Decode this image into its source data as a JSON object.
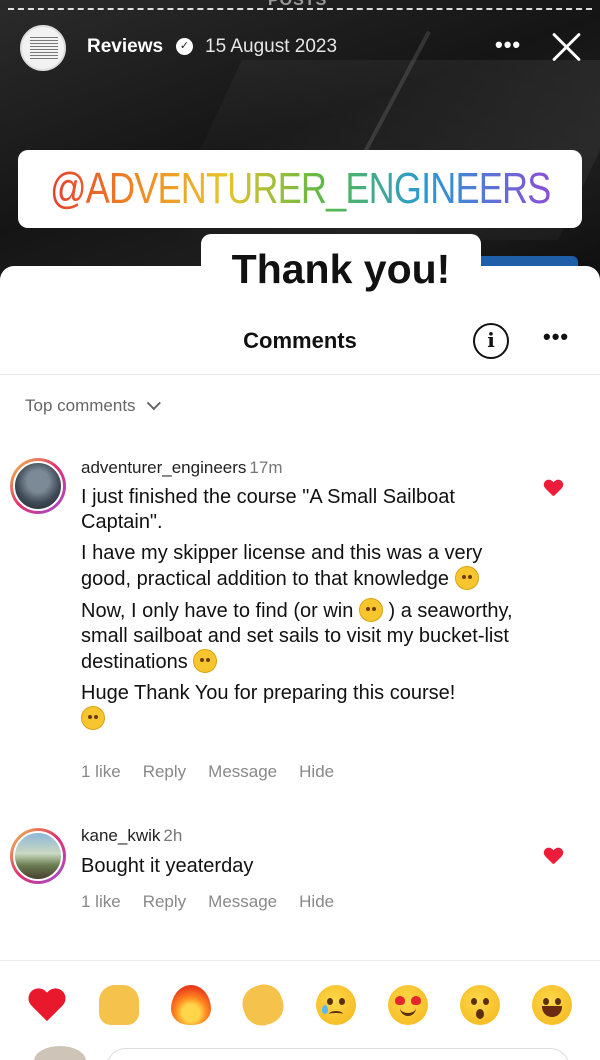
{
  "story": {
    "peek_label": "POSTS",
    "account_name": "Reviews",
    "date": "15 August 2023",
    "more_label": "•••",
    "mention": "@ADVENTURER_ENGINEERS",
    "thanks": "Thank you!"
  },
  "sheet": {
    "title": "Comments",
    "more_label": "•••",
    "info_label": "i",
    "sort_label": "Top comments"
  },
  "comments": [
    {
      "username": "adventurer_engineers",
      "time": "17m",
      "paragraphs": [
        "I just finished the course \"A Small Sailboat Captain\".",
        "I have my skipper license and this was a very good, practical addition to that knowledge",
        "Now, I only have to find (or win",
        ") a seaworthy, small sailboat and set sails to visit my bucket-list destinations",
        "Huge Thank You for preparing this course!"
      ],
      "likes": "1 like",
      "reply": "Reply",
      "message": "Message",
      "hide": "Hide"
    },
    {
      "username": "kane_kwik",
      "time": "2h",
      "text": "Bought it yeaterday",
      "likes": "1 like",
      "reply": "Reply",
      "message": "Message",
      "hide": "Hide"
    }
  ],
  "reactions": [
    "red-heart",
    "raising-hands",
    "fire",
    "clapping-hands",
    "crying-face",
    "heart-eyes-face",
    "surprised-face",
    "tears-of-joy-face"
  ],
  "colors": {
    "heart": "#ed1c3a",
    "sheet_bg": "#ffffff",
    "muted_text": "#888888"
  }
}
